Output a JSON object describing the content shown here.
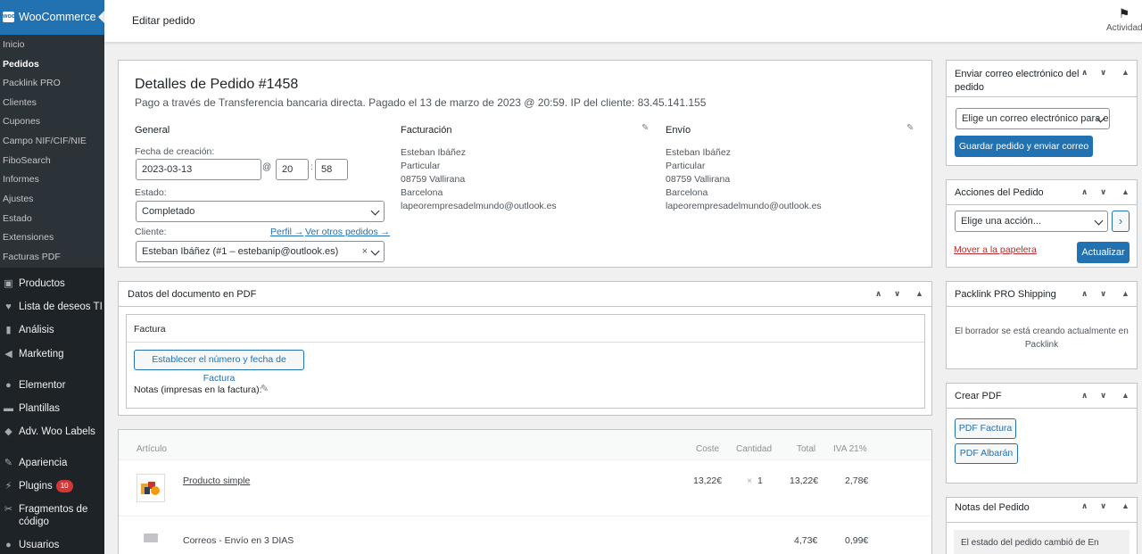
{
  "sidebar": {
    "brand": "WooCommerce",
    "submenu": [
      "Inicio",
      "Pedidos",
      "Packlink PRO",
      "Clientes",
      "Cupones",
      "Campo NIF/CIF/NIE",
      "FiboSearch",
      "Informes",
      "Ajustes",
      "Estado",
      "Extensiones",
      "Facturas PDF"
    ],
    "current": "Pedidos",
    "menu": [
      {
        "label": "Productos",
        "icon": "archive-icon"
      },
      {
        "label": "Lista de deseos TI",
        "icon": "heart-icon"
      },
      {
        "label": "Análisis",
        "icon": "bar-chart-icon"
      },
      {
        "label": "Marketing",
        "icon": "megaphone-icon"
      },
      {
        "label": "Elementor",
        "icon": "elementor-icon"
      },
      {
        "label": "Plantillas",
        "icon": "folder-icon"
      },
      {
        "label": "Adv. Woo Labels",
        "icon": "tag-icon"
      },
      {
        "label": "Apariencia",
        "icon": "paintbrush-icon"
      },
      {
        "label": "Plugins",
        "icon": "plugin-icon",
        "badge": "10"
      },
      {
        "label": "Fragmentos de código",
        "icon": "scissors-icon"
      },
      {
        "label": "Usuarios",
        "icon": "user-icon"
      }
    ]
  },
  "topbar": {
    "title": "Editar pedido",
    "activity_label": "Actividad"
  },
  "order": {
    "heading": "Detalles de Pedido #1458",
    "subtitle": "Pago a través de Transferencia bancaria directa. Pagado el 13 de marzo de 2023 @ 20:59. IP del cliente: 83.45.141.155",
    "general": {
      "title": "General",
      "date_label": "Fecha de creación:",
      "date": "2023-03-13",
      "at": "@",
      "hour": "20",
      "colon": ":",
      "minute": "58",
      "status_label": "Estado:",
      "status": "Completado",
      "customer_label": "Cliente:",
      "profile_link": "Perfil →",
      "other_orders_link": "Ver otros pedidos →",
      "customer": "Esteban Ibáñez (#1 – estebanip@outlook.es)",
      "clear": "×"
    },
    "billing": {
      "title": "Facturación",
      "lines": [
        "Esteban Ibáñez",
        "Particular",
        "08759 Vallirana",
        "Barcelona",
        "lapeorempresadelmundo@outlook.es"
      ]
    },
    "shipping": {
      "title": "Envío",
      "lines": [
        "Esteban Ibáñez",
        "Particular",
        "08759 Vallirana",
        "Barcelona",
        "lapeorempresadelmundo@outlook.es"
      ]
    }
  },
  "pdf_box": {
    "title": "Datos del documento en PDF",
    "invoice_title": "Factura",
    "set_button": "Establecer el número y fecha de Factura",
    "notes_label": "Notas (impresas en la factura):"
  },
  "items": {
    "headers": {
      "article": "Artículo",
      "cost": "Coste",
      "qty": "Cantidad",
      "total": "Total",
      "tax": "IVA 21%"
    },
    "product": {
      "name": "Producto simple",
      "cost": "13,22€",
      "times": "×",
      "qty": "1",
      "total": "13,22€",
      "tax": "2,78€"
    },
    "shipping": {
      "name": "Correos - Envío en 3 DIAS",
      "total": "4,73€",
      "tax": "0,99€"
    }
  },
  "right": {
    "email": {
      "title": "Enviar correo electrónico del pedido",
      "select": "Elige un correo electrónico para enviar",
      "button": "Guardar pedido y enviar correo"
    },
    "actions": {
      "title": "Acciones del Pedido",
      "select": "Elige una acción...",
      "go": "›",
      "trash": "Mover a la papelera",
      "update": "Actualizar"
    },
    "packlink": {
      "title": "Packlink PRO Shipping",
      "text": "El borrador se está creando actualmente en Packlink"
    },
    "createpdf": {
      "title": "Crear PDF",
      "invoice": "PDF Factura",
      "delivery": "PDF Albarán"
    },
    "notes": {
      "title": "Notas del Pedido",
      "first_note": "El estado del pedido cambió de En"
    }
  },
  "colors": {
    "accent": "#2271b1",
    "sidebar": "#1d2327",
    "submenu": "#2c3338",
    "badge": "#d63638"
  }
}
